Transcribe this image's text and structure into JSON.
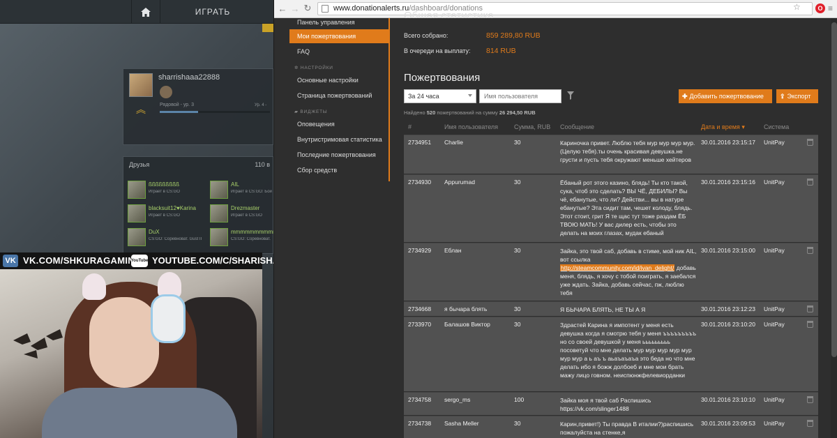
{
  "csgo": {
    "play_label": "ИГРАТЬ",
    "profile": {
      "name": "sharrishaaa22888",
      "rank": "Рядовой - ур. 3",
      "level": "Ур. 4 -",
      "xp_fraction": 0.35
    },
    "friends": {
      "title": "Друзья",
      "count": "110 в",
      "items": [
        {
          "name": "ßßßßßßßßß",
          "status": "Играет в CS:GO"
        },
        {
          "name": "AIL",
          "status": "Играет в CS:GO: Бой"
        },
        {
          "name": "blacksuit12♥Karina",
          "status": "Играет в CS:GO"
        },
        {
          "name": "Drezmaster",
          "status": "Играет в CS:GO"
        },
        {
          "name": "DuX",
          "status": "CS:GO: Соревноват. Gust II"
        },
        {
          "name": "mmmmmmmmmm",
          "status": "CS:GO: Соревноват."
        }
      ]
    }
  },
  "social": {
    "vk_icon": "VK",
    "vk_text": "VK.COM/SHKURAGAMING",
    "yt_icon": "YouTube",
    "yt_text": "YOUTUBE.COM/C/SHARISHAXD"
  },
  "browser": {
    "url_host": "www.donationalerts.ru",
    "url_path": "/dashboard/donations"
  },
  "sidebar": {
    "items": [
      {
        "label": "Панель управления"
      },
      {
        "label": "Мои пожертвования",
        "active": true
      },
      {
        "label": "FAQ"
      }
    ],
    "settings_heading": "НАСТРОЙКИ",
    "settings_items": [
      {
        "label": "Основные настройки"
      },
      {
        "label": "Страница пожертвований"
      }
    ],
    "widgets_heading": "ВИДЖЕТЫ",
    "widgets_items": [
      {
        "label": "Оповещения"
      },
      {
        "label": "Внутристримовая статистика"
      },
      {
        "label": "Последние пожертвования"
      },
      {
        "label": "Сбор средств"
      }
    ]
  },
  "stats": {
    "title": "Общая статистика",
    "total_label": "Всего собрано:",
    "total_value": "859 289,80 RUB",
    "queue_label": "В очереди на выплату:",
    "queue_value": "814 RUB"
  },
  "donations": {
    "title": "Пожертвования",
    "period": "За 24 часа",
    "user_placeholder": "Имя пользователя",
    "add_label": "Добавить пожертвование",
    "export_label": "Экспорт",
    "found_prefix": "Найдено",
    "found_count": "520",
    "found_mid": "пожертвований на сумму",
    "found_sum": "26 294,50 RUB",
    "headers": {
      "id": "#",
      "user": "Имя пользователя",
      "amount": "Сумма, RUB",
      "message": "Сообщение",
      "date": "Дата и время",
      "system": "Система"
    },
    "rows": [
      {
        "id": "2734951",
        "user": "Charlie",
        "amount": "30",
        "message": "Кариночка привет. Люблю тебя мур мур мур мур. (Целую тебя).ты очень красивая девушка.не грусти и пусть тебя окружают меньше хейтеров",
        "date": "30.01.2016 23:15:17",
        "system": "UnitPay"
      },
      {
        "id": "2734930",
        "user": "Appurumad",
        "amount": "30",
        "message": "Ёбаный рот этого казино, блядь! Ты кто такой, сука, чтоб это сделать? ВЫ ЧЁ, ДЕБИЛЫ? Вы чё, ебанутые, что ли? Действи... вы в натуре ебанутые? Эта сидит там, чешет колоду, блядь. Этот стоит, грит Я те щас тут тоже раздам ЁБ ТВОЮ МАТЬ! У вас дилер есть, чтобы это делать на моих глазах, мудак ебаный",
        "date": "30.01.2016 23:15:16",
        "system": "UnitPay"
      },
      {
        "id": "2734929",
        "user": "Еблан",
        "amount": "30",
        "message_before": "Зайка, это твой саб, добавь в стиме, мой ник AIL, вот ссылка",
        "link": "http://steamcommunity.com/id/ivan_delight/",
        "message_after": "добавь меня, блядь, я хочу с тобой поиграть, я заебался уже ждать. Зайка, добавь сейчас, пж, люблю тебя",
        "date": "30.01.2016 23:15:00",
        "system": "UnitPay"
      },
      {
        "id": "2734668",
        "user": "я бычара блять",
        "amount": "30",
        "message": "Я БЫЧАРА БЛЯТЬ, НЕ ТЫ А Я",
        "date": "30.01.2016 23:12:23",
        "system": "UnitPay"
      },
      {
        "id": "2733970",
        "user": "Балашов Виктор",
        "amount": "30",
        "message": "Здрастей Карина я импотент у меня есть девушка когда я смотрю тебя у меня ъъъъъъъъъ но со своей девушкой у меня ььььььььь посоветуй что мне делать мур мур мур мур мур мур мур а ь аъ ъ аьаъаъаъа это беда но что мне делать ибо я божж долбоеб и мне мои брать мажу лицо говном. неиспюнжфелевиорданки",
        "date": "30.01.2016 23:10:20",
        "system": "UnitPay"
      },
      {
        "id": "2734758",
        "user": "sergo_ms",
        "amount": "100",
        "message": "Зайка моя я твой саб Распишись https://vk.com/slinger1488",
        "date": "30.01.2016 23:10:10",
        "system": "UnitPay"
      },
      {
        "id": "2734738",
        "user": "Sasha Meller",
        "amount": "30",
        "message": "Карин,привет!) Ты правда В италии?)распишись пожалуйста на стенке,я",
        "date": "30.01.2016 23:09:53",
        "system": "UnitPay"
      }
    ]
  },
  "colors": {
    "accent": "#e07b1b",
    "row_bg": "#515151",
    "page_bg": "#2e2e2e"
  },
  "icons": [
    "home-icon",
    "vk-icon",
    "youtube-icon",
    "back-icon",
    "forward-icon",
    "reload-icon",
    "lock-icon",
    "star-icon",
    "opera-icon",
    "menu-icon",
    "gear-icon",
    "widget-icon",
    "filter-icon",
    "plus-icon",
    "export-icon",
    "trash-icon",
    "sort-arrow-icon"
  ]
}
